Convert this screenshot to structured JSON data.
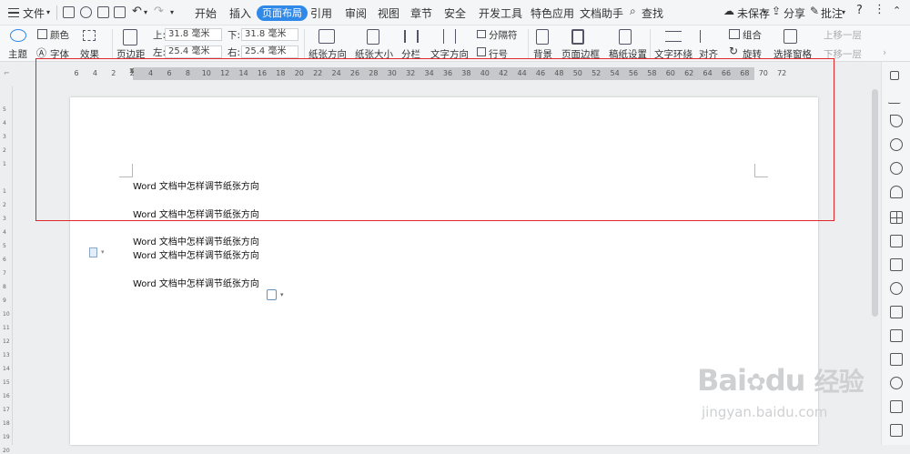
{
  "menubar": {
    "file": "文件",
    "tabs": [
      "开始",
      "插入",
      "页面布局",
      "引用",
      "审阅",
      "视图",
      "章节",
      "安全",
      "开发工具",
      "特色应用",
      "文档助手"
    ],
    "active_tab": "页面布局",
    "search": "查找",
    "unsaved": "未保存",
    "share": "分享",
    "comment": "批注",
    "help": "?"
  },
  "ribbon": {
    "theme": "主题",
    "colors": "颜色",
    "fonts": "字体",
    "effects": "效果",
    "margins": "页边距",
    "top_label": "上:",
    "top_value": "31.8 毫米",
    "bottom_label": "下:",
    "bottom_value": "31.8 毫米",
    "left_label": "左:",
    "left_value": "25.4 毫米",
    "right_label": "右:",
    "right_value": "25.4 毫米",
    "orientation": "纸张方向",
    "size": "纸张大小",
    "columns": "分栏",
    "text_direction": "文字方向",
    "breaks": "分隔符",
    "line_numbers": "行号",
    "background": "背景",
    "page_borders": "页面边框",
    "grid_paper": "稿纸设置",
    "wrap_text": "文字环绕",
    "align": "对齐",
    "group": "组合",
    "rotate": "旋转",
    "selection_pane": "选择窗格",
    "bring_forward": "上移一层",
    "send_backward": "下移一层"
  },
  "ruler": {
    "numbers": [
      "6",
      "4",
      "2",
      "2",
      "4",
      "6",
      "8",
      "10",
      "12",
      "14",
      "16",
      "18",
      "20",
      "22",
      "24",
      "26",
      "28",
      "30",
      "32",
      "34",
      "36",
      "38",
      "40",
      "42",
      "44",
      "46",
      "48",
      "50",
      "52",
      "54",
      "56",
      "58",
      "60",
      "62",
      "64",
      "66",
      "68",
      "70",
      "72"
    ]
  },
  "document": {
    "lines": [
      "Word 文档中怎样调节纸张方向",
      "Word 文档中怎样调节纸张方向",
      "Word 文档中怎样调节纸张方向",
      "Word 文档中怎样调节纸张方向",
      "Word 文档中怎样调节纸张方向"
    ]
  },
  "watermark": {
    "brand": "Bai",
    "brand2": "du",
    "cn": "经验",
    "url": "jingyan.baidu.com"
  },
  "colors": {
    "accent": "#2f89e8",
    "highlight": "#e0262b"
  }
}
